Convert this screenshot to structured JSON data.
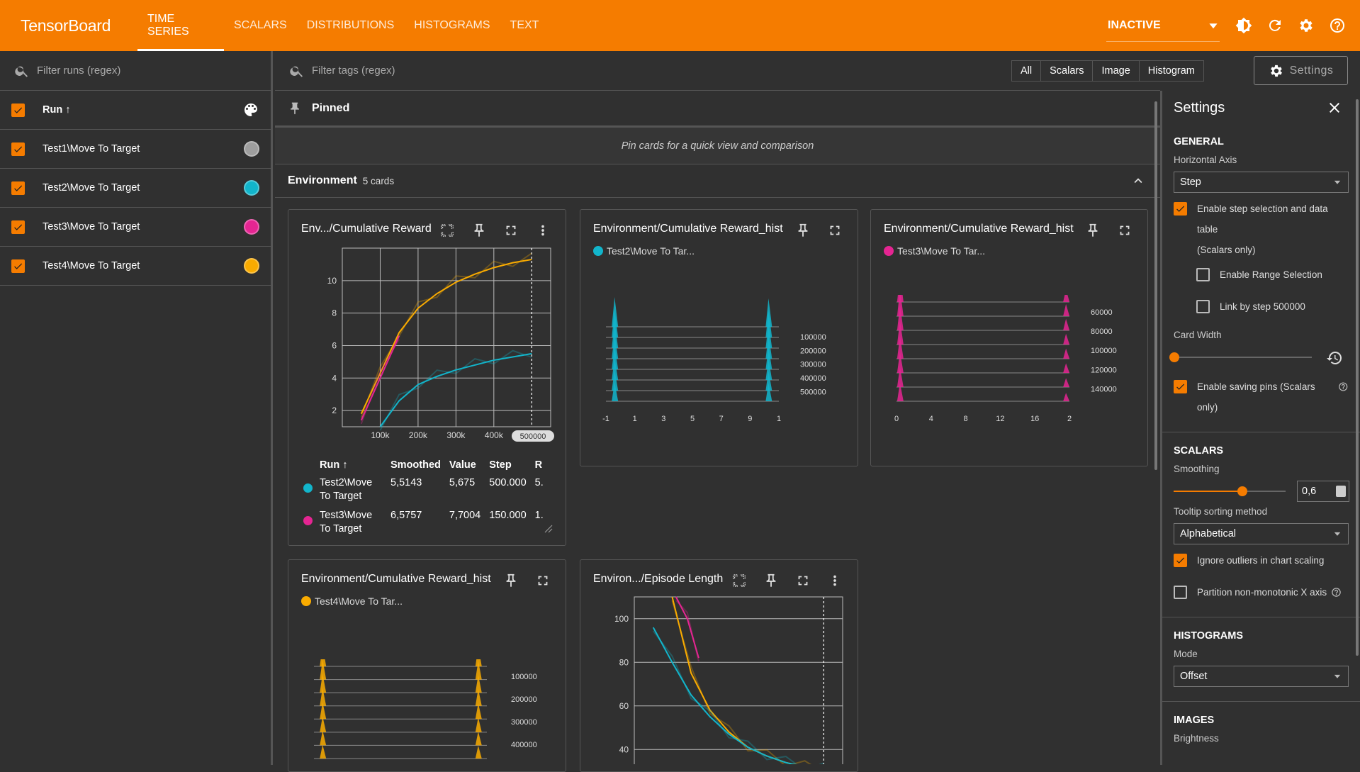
{
  "app": {
    "title": "TensorBoard"
  },
  "nav": {
    "tabs": [
      "TIME SERIES",
      "SCALARS",
      "DISTRIBUTIONS",
      "HISTOGRAMS",
      "TEXT"
    ],
    "status": "INACTIVE"
  },
  "sidebar": {
    "filter_placeholder": "Filter runs (regex)",
    "run_header": "Run ↑",
    "runs": [
      {
        "name": "Test1\\Move To Target",
        "color": "#9e9e9e"
      },
      {
        "name": "Test2\\Move To Target",
        "color": "#12b5cb"
      },
      {
        "name": "Test3\\Move To Target",
        "color": "#e52592"
      },
      {
        "name": "Test4\\Move To Target",
        "color": "#f9ab00"
      }
    ]
  },
  "main": {
    "filter_placeholder": "Filter tags (regex)",
    "types": [
      "All",
      "Scalars",
      "Image",
      "Histogram"
    ],
    "settings_label": "Settings",
    "pinned_label": "Pinned",
    "pinned_msg": "Pin cards for a quick view and comparison",
    "group": {
      "name": "Environment",
      "count": "5 cards"
    }
  },
  "cards": {
    "c1": {
      "title": "Env.../Cumulative Reward",
      "step_badge": "500000",
      "table": {
        "headers": [
          "Run ↑",
          "Smoothed",
          "Value",
          "Step",
          "R"
        ],
        "rows": [
          {
            "run": "Test2\\Move To Target",
            "smoothed": "5,5143",
            "value": "5,675",
            "step": "500.000",
            "r": "5.",
            "color": "#12b5cb"
          },
          {
            "run": "Test3\\Move To Target",
            "smoothed": "6,5757",
            "value": "7,7004",
            "step": "150.000",
            "r": "1.",
            "color": "#e52592"
          }
        ]
      }
    },
    "c2": {
      "title": "Environment/Cumulative Reward_hist",
      "legend": "Test2\\Move To Tar...",
      "legend_color": "#12b5cb"
    },
    "c3": {
      "title": "Environment/Cumulative Reward_hist",
      "legend": "Test3\\Move To Tar...",
      "legend_color": "#e52592"
    },
    "c4": {
      "title": "Environment/Cumulative Reward_hist",
      "legend": "Test4\\Move To Tar...",
      "legend_color": "#f9ab00"
    },
    "c5": {
      "title": "Environ.../Episode Length"
    }
  },
  "chart_data": [
    {
      "type": "line",
      "title": "Env.../Cumulative Reward",
      "x_ticks": [
        "100k",
        "200k",
        "300k",
        "400k"
      ],
      "y_ticks": [
        "2",
        "4",
        "6",
        "8",
        "10"
      ],
      "xlim": [
        0,
        550000
      ],
      "ylim": [
        1,
        12
      ],
      "series": [
        {
          "name": "Test4\\Move To Target",
          "color": "#f9ab00",
          "x": [
            50000,
            100000,
            150000,
            200000,
            250000,
            300000,
            350000,
            400000,
            450000,
            500000
          ],
          "y": [
            1.8,
            4.3,
            6.8,
            8.3,
            9.2,
            9.9,
            10.4,
            10.8,
            11.1,
            11.3
          ]
        },
        {
          "name": "Test3\\Move To Target",
          "color": "#e52592",
          "x": [
            50000,
            100000,
            150000
          ],
          "y": [
            1.4,
            4.0,
            6.6
          ]
        },
        {
          "name": "Test2\\Move To Target",
          "color": "#12b5cb",
          "x": [
            100000,
            150000,
            200000,
            250000,
            300000,
            350000,
            400000,
            450000,
            500000
          ],
          "y": [
            1.0,
            2.6,
            3.6,
            4.1,
            4.5,
            4.8,
            5.1,
            5.3,
            5.5
          ]
        }
      ]
    },
    {
      "type": "histogram",
      "x_ticks": [
        "-1",
        "1",
        "3",
        "5",
        "7",
        "9",
        "1"
      ],
      "y_ticks": [
        "100000",
        "200000",
        "300000",
        "400000",
        "500000"
      ]
    },
    {
      "type": "histogram",
      "x_ticks": [
        "0",
        "4",
        "8",
        "12",
        "16",
        "2"
      ],
      "y_ticks": [
        "60000",
        "80000",
        "100000",
        "120000",
        "140000"
      ]
    },
    {
      "type": "histogram",
      "y_ticks": [
        "100000",
        "200000",
        "300000",
        "400000"
      ]
    },
    {
      "type": "line",
      "title": "Environ.../Episode Length",
      "y_ticks": [
        "40",
        "60",
        "80",
        "100"
      ],
      "xlim": [
        0,
        550000
      ],
      "ylim": [
        30,
        110
      ],
      "series": [
        {
          "name": "Test4\\Move To Target",
          "color": "#f9ab00",
          "x": [
            100000,
            150000,
            200000,
            250000,
            300000,
            350000,
            400000,
            450000,
            500000
          ],
          "y": [
            110,
            75,
            58,
            48,
            41,
            37,
            34,
            32,
            31
          ]
        },
        {
          "name": "Test3\\Move To Target",
          "color": "#e52592",
          "x": [
            110000,
            140000,
            170000
          ],
          "y": [
            110,
            100,
            82
          ]
        },
        {
          "name": "Test2\\Move To Target",
          "color": "#12b5cb",
          "x": [
            50000,
            100000,
            150000,
            200000,
            250000,
            300000,
            350000,
            400000,
            450000,
            500000
          ],
          "y": [
            96,
            80,
            65,
            55,
            47,
            41,
            37,
            34,
            32,
            31
          ]
        }
      ]
    }
  ],
  "settings": {
    "title": "Settings",
    "general": {
      "heading": "GENERAL",
      "haxis_label": "Horizontal Axis",
      "haxis_value": "Step",
      "opt_step": "Enable step selection and data table",
      "opt_step2": "(Scalars only)",
      "opt_range": "Enable Range Selection",
      "opt_link": "Link by step 500000",
      "card_width_label": "Card Width",
      "opt_pins": "Enable saving pins (Scalars only)"
    },
    "scalars": {
      "heading": "SCALARS",
      "smoothing_label": "Smoothing",
      "smoothing_value": "0,6",
      "tooltip_label": "Tooltip sorting method",
      "tooltip_value": "Alphabetical",
      "opt_outliers": "Ignore outliers in chart scaling",
      "opt_partition": "Partition non-monotonic X axis"
    },
    "histograms": {
      "heading": "HISTOGRAMS",
      "mode_label": "Mode",
      "mode_value": "Offset"
    },
    "images": {
      "heading": "IMAGES",
      "brightness_label": "Brightness"
    }
  }
}
